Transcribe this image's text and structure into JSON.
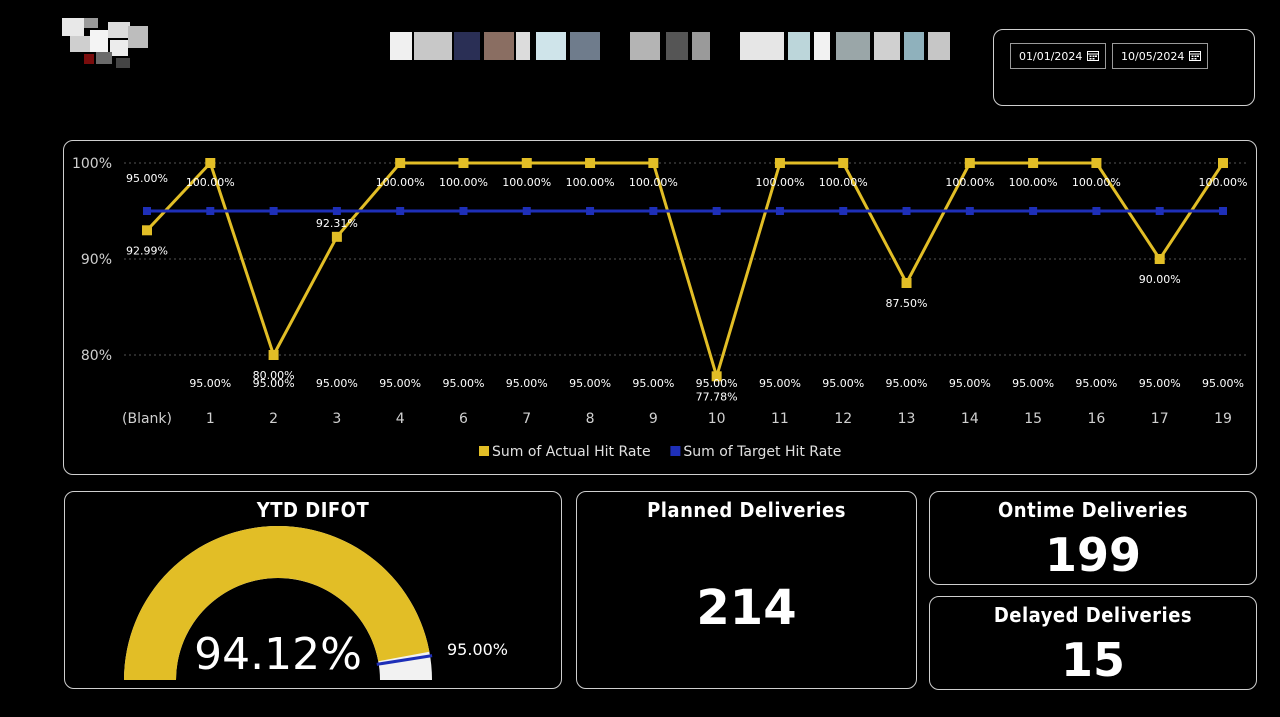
{
  "date_range": {
    "start": "01/01/2024",
    "end": "10/05/2024"
  },
  "chart_data": {
    "type": "line",
    "categories": [
      "(Blank)",
      "1",
      "2",
      "3",
      "4",
      "6",
      "7",
      "8",
      "9",
      "10",
      "11",
      "12",
      "13",
      "14",
      "15",
      "16",
      "17",
      "19"
    ],
    "series": [
      {
        "name": "Sum of Actual Hit Rate",
        "color": "#E2BE26",
        "values": [
          92.99,
          100,
          80,
          92.31,
          100,
          100,
          100,
          100,
          100,
          77.78,
          100,
          100,
          87.5,
          100,
          100,
          100,
          90,
          100
        ],
        "labels": [
          "92.99%",
          "100.00%",
          "80.00%",
          "92.31%",
          "100.00%",
          "100.00%",
          "100.00%",
          "100.00%",
          "100.00%",
          "77.78%",
          "100.00%",
          "100.00%",
          "87.50%",
          "100.00%",
          "100.00%",
          "100.00%",
          "90.00%",
          "100.00%"
        ]
      },
      {
        "name": "Sum of Target Hit Rate",
        "color": "#1E2FB8",
        "values": [
          95,
          95,
          95,
          95,
          95,
          95,
          95,
          95,
          95,
          95,
          95,
          95,
          95,
          95,
          95,
          95,
          95,
          95
        ],
        "labels": [
          "95.00%",
          "95.00%",
          "95.00%",
          "95.00%",
          "95.00%",
          "95.00%",
          "95.00%",
          "95.00%",
          "95.00%",
          "95.00%",
          "95.00%",
          "95.00%",
          "95.00%",
          "95.00%",
          "95.00%",
          "95.00%",
          "95.00%",
          "95.00%"
        ]
      }
    ],
    "y_ticks": [
      "100%",
      "90%",
      "80%"
    ],
    "ylim": [
      75,
      100
    ],
    "grid": true,
    "legend": "bottom-center"
  },
  "gauge": {
    "title": "YTD DIFOT",
    "value": 94.12,
    "value_label": "94.12%",
    "target": 95.0,
    "target_label": "95.00%",
    "min": 0,
    "max": 100,
    "fill_color": "#E2BE26",
    "track_color": "#F2F2F2",
    "target_color": "#1E2FB8"
  },
  "cards": {
    "planned": {
      "title": "Planned Deliveries",
      "value": "214"
    },
    "ontime": {
      "title": "Ontime Deliveries",
      "value": "199"
    },
    "delayed": {
      "title": "Delayed Deliveries",
      "value": "15"
    }
  }
}
